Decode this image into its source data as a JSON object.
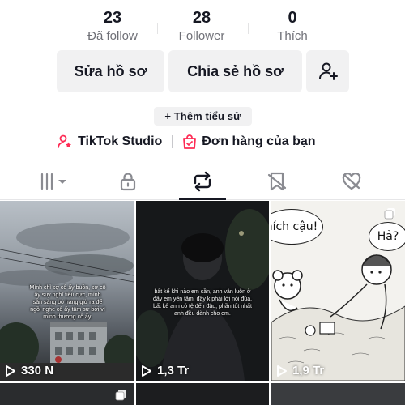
{
  "stats": [
    {
      "value": "23",
      "label": "Đã follow"
    },
    {
      "value": "28",
      "label": "Follower"
    },
    {
      "value": "0",
      "label": "Thích"
    }
  ],
  "buttons": {
    "edit_profile": "Sửa hồ sơ",
    "share_profile": "Chia sẻ hồ sơ",
    "add_friend_icon": "person-add-icon"
  },
  "bio": {
    "add_bio": "+ Thêm tiểu sử"
  },
  "links": {
    "studio": "TikTok Studio",
    "orders": "Đơn hàng của bạn"
  },
  "tabs": [
    {
      "icon": "grid-icon",
      "selected": false
    },
    {
      "icon": "lock-icon",
      "selected": false
    },
    {
      "icon": "repost-icon",
      "selected": true
    },
    {
      "icon": "bookmark-icon",
      "selected": false
    },
    {
      "icon": "liked-icon",
      "selected": false
    }
  ],
  "colors": {
    "accent": "#fe2c55",
    "text": "#161823",
    "muted": "#6f7077",
    "button_bg": "#f1f1f2"
  },
  "videos": [
    {
      "views": "330 N",
      "caption": "Mình chỉ sợ cô ấy buồn, sợ cô ấy suy nghĩ tiêu cực, mình sẵn sàng bỏ hàng giờ ra để ngồi nghe cô ấy tâm sự bởi vì mình thương cô ấy."
    },
    {
      "views": "1,3 Tr",
      "caption": "bất kể khi nào em cần, anh vẫn luôn ở đây em yên tâm, đây k phải lời nói đùa, bất kể anh có tệ đến đâu, phần tốt nhất anh đều dành cho em."
    },
    {
      "views": "1,9 Tr",
      "bubble1": "ních cậu!",
      "bubble2": "Hả?"
    }
  ]
}
